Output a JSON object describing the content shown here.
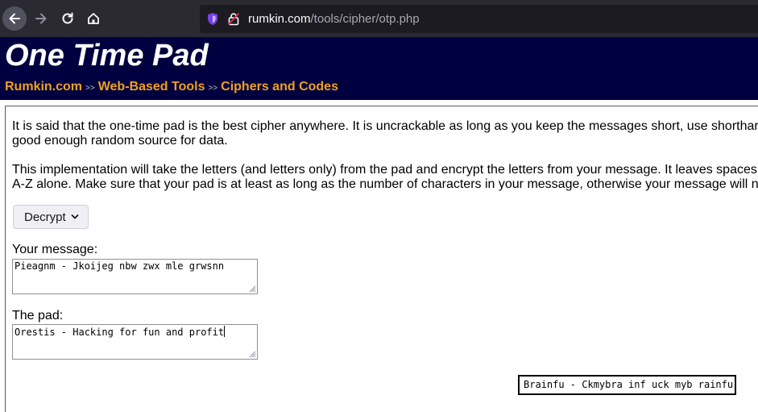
{
  "browser": {
    "url_host": "rumkin.com",
    "url_path": "/tools/cipher/otp.php"
  },
  "header": {
    "title": "One Time Pad",
    "breadcrumbs": [
      "Rumkin.com",
      "Web-Based Tools",
      "Ciphers and Codes"
    ],
    "separator": ">>"
  },
  "content": {
    "para1_line1": "It is said that the one-time pad is the best cipher anywhere. It is uncrackable as long as you keep the messages short, use shorthar",
    "para1_line2": "good enough random source for data.",
    "para2_line1": "This implementation will take the letters (and letters only) from the pad and encrypt the letters from your message. It leaves spaces",
    "para2_line2": "A-Z alone. Make sure that your pad is at least as long as the number of characters in your message, otherwise your message will n",
    "mode_selected": "Decrypt",
    "message_label": "Your message:",
    "message_value": "Pieagnm - Jkoijeg nbw zwx mle grwsnn",
    "pad_label": "The pad:",
    "pad_value": "Orestis - Hacking for fun and profit",
    "result": "Brainfu - Ckmybra inf uck myb rainfu"
  },
  "colors": {
    "header_bg": "#000040",
    "breadcrumb": "#f0a020",
    "toolbar_bg": "#2b2a33"
  }
}
